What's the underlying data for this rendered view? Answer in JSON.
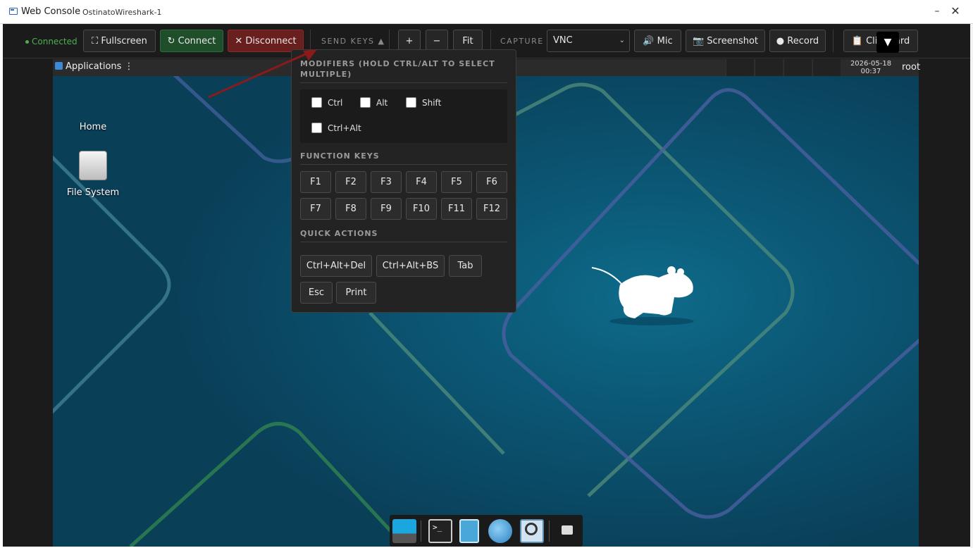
{
  "window": {
    "title": "Web Console",
    "subtitle": "OstinatoWireshark-1",
    "minimize": "–",
    "close": "✕"
  },
  "toolbar": {
    "status": "Connected",
    "fullscreen": "⛶ Fullscreen",
    "connect": "↻ Connect",
    "disconnect": "✕ Disconnect",
    "send_keys": "SEND KEYS ▲",
    "zoom_in": "+",
    "zoom_out": "−",
    "fit": "Fit",
    "capture_label": "CAPTURE",
    "capture_value": "VNC",
    "mic": "🔊 Mic",
    "screenshot": "📷 Screenshot",
    "record": "● Record",
    "clipboard": "📋 Clipboard",
    "dropdown_toggle": "▼"
  },
  "desktop": {
    "panel": {
      "applications": "Applications ⋮",
      "clock_date": "2026-05-18",
      "clock_time": "00:37",
      "user": "root"
    },
    "icons": [
      {
        "label": "Home"
      },
      {
        "label": "File System"
      }
    ],
    "dock_items": [
      "desktop",
      "terminal",
      "file-manager",
      "web-browser",
      "app-finder",
      "folder"
    ]
  },
  "send_keys_menu": {
    "modifiers_title": "MODIFIERS (HOLD CTRL/ALT TO SELECT MULTIPLE)",
    "modifiers": [
      "Ctrl",
      "Alt",
      "Shift",
      "Ctrl+Alt"
    ],
    "function_title": "FUNCTION KEYS",
    "function_keys": [
      "F1",
      "F2",
      "F3",
      "F4",
      "F5",
      "F6",
      "F7",
      "F8",
      "F9",
      "F10",
      "F11",
      "F12"
    ],
    "quick_title": "QUICK ACTIONS",
    "quick_actions": [
      "Ctrl+Alt+Del",
      "Ctrl+Alt+BS",
      "Tab",
      "Esc",
      "Print"
    ]
  },
  "colors": {
    "connected": "#4caf50",
    "desktop_bg": "#0a4a66",
    "connect_btn": "#1f4e2a",
    "disconnect_btn": "#6a1f1f"
  }
}
